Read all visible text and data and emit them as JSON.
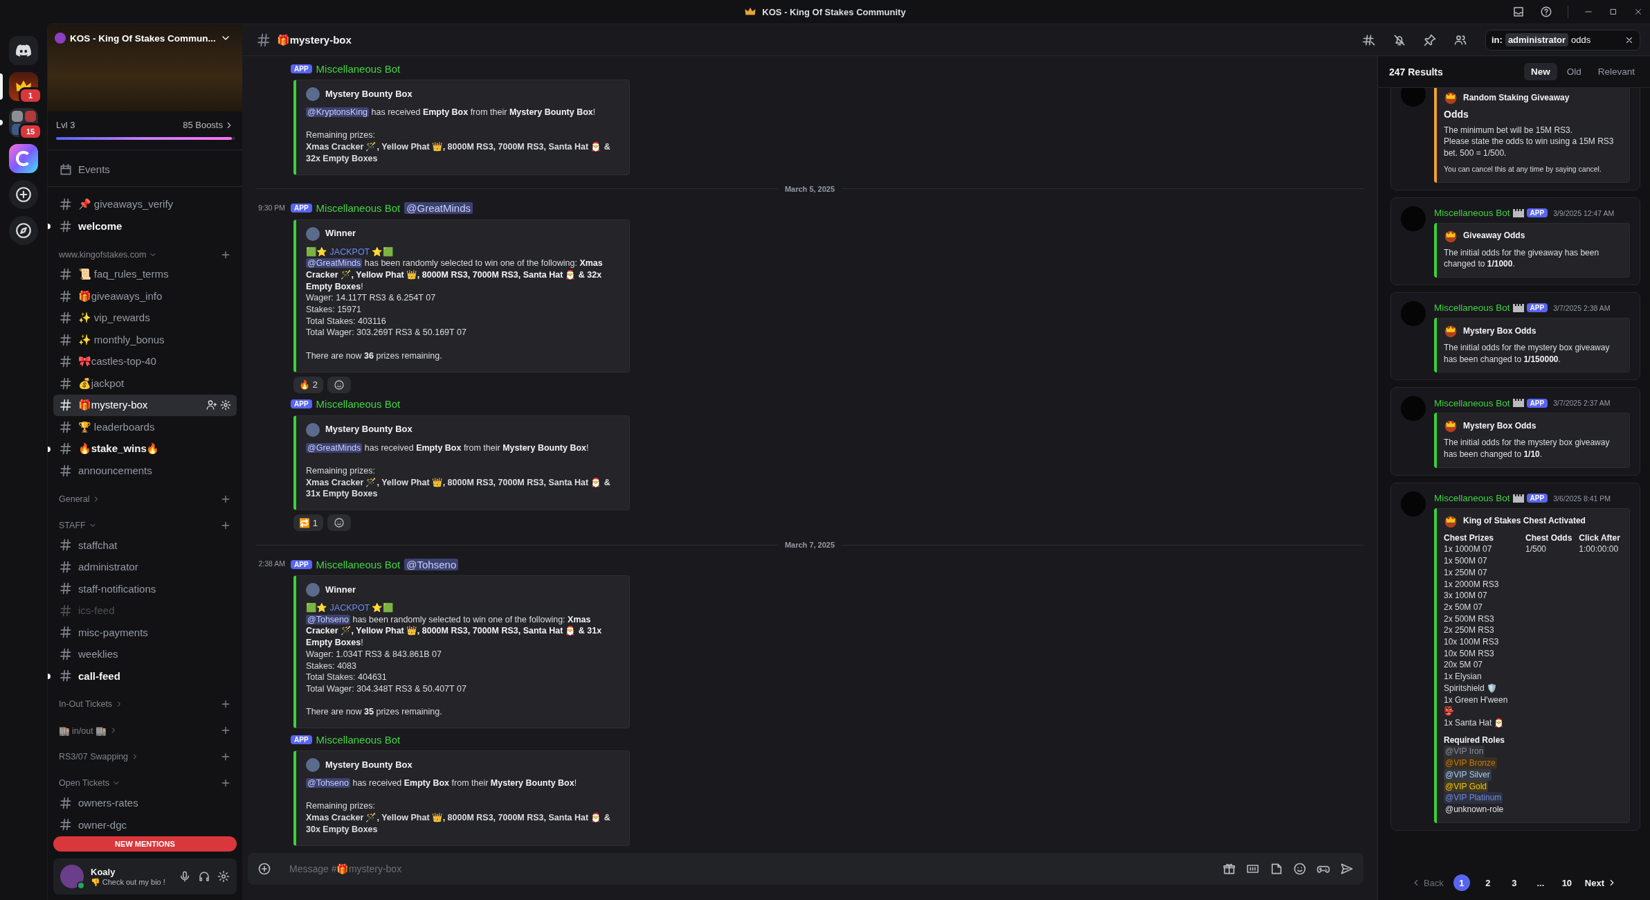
{
  "window": {
    "title": "KOS - King Of Stakes Community"
  },
  "servers": [
    {
      "kind": "home",
      "selected": false,
      "unread": false
    },
    {
      "kind": "server",
      "badge": "1",
      "selected": true,
      "unread": false
    },
    {
      "kind": "folder",
      "badge": "15",
      "selected": false,
      "unread": true
    },
    {
      "kind": "app",
      "selected": false,
      "unread": false
    },
    {
      "kind": "add",
      "selected": false,
      "unread": false
    },
    {
      "kind": "discover",
      "selected": false,
      "unread": false
    }
  ],
  "server": {
    "name": "KOS - King Of Stakes Commun...",
    "tier": "Lvl 3",
    "boosts": "85 Boosts",
    "boost_bar": {
      "level": 0.98
    }
  },
  "sidebar": {
    "items": [
      {
        "kind": "events",
        "name": "Events"
      },
      {
        "kind": "channel",
        "name": "📌 giveaways_verify",
        "selected": false,
        "unread": false,
        "muted": false
      },
      {
        "kind": "channel",
        "name": "welcome",
        "selected": false,
        "unread": true,
        "muted": false
      },
      {
        "kind": "category",
        "name": "www.kingofstakes.com",
        "expanded": true
      },
      {
        "kind": "channel",
        "name": "📜 faq_rules_terms",
        "selected": false,
        "unread": false,
        "muted": false
      },
      {
        "kind": "channel",
        "name": "🎁giveaways_info",
        "selected": false,
        "unread": false,
        "muted": false
      },
      {
        "kind": "channel",
        "name": "✨ vip_rewards",
        "selected": false,
        "unread": false,
        "muted": false
      },
      {
        "kind": "channel",
        "name": "✨ monthly_bonus",
        "selected": false,
        "unread": false,
        "muted": false
      },
      {
        "kind": "channel",
        "name": "🎀castles-top-40",
        "selected": false,
        "unread": false,
        "muted": false
      },
      {
        "kind": "channel",
        "name": "💰jackpot",
        "selected": false,
        "unread": false,
        "muted": false
      },
      {
        "kind": "channel",
        "name": "🎁mystery-box",
        "selected": true,
        "unread": false,
        "muted": false
      },
      {
        "kind": "channel",
        "name": "🏆 leaderboards",
        "selected": false,
        "unread": false,
        "muted": false
      },
      {
        "kind": "channel",
        "name": "🔥stake_wins🔥",
        "selected": false,
        "unread": true,
        "muted": false
      },
      {
        "kind": "channel",
        "name": "announcements",
        "selected": false,
        "unread": false,
        "muted": false
      },
      {
        "kind": "category",
        "name": "General",
        "expanded": false
      },
      {
        "kind": "category",
        "name": "STAFF",
        "expanded": true
      },
      {
        "kind": "channel",
        "name": "staffchat",
        "selected": false,
        "unread": false,
        "muted": false
      },
      {
        "kind": "channel",
        "name": "administrator",
        "selected": false,
        "unread": false,
        "muted": false
      },
      {
        "kind": "channel",
        "name": "staff-notifications",
        "selected": false,
        "unread": false,
        "muted": false
      },
      {
        "kind": "channel",
        "name": "ics-feed",
        "selected": false,
        "unread": false,
        "muted": true
      },
      {
        "kind": "channel",
        "name": "misc-payments",
        "selected": false,
        "unread": false,
        "muted": false
      },
      {
        "kind": "channel",
        "name": "weeklies",
        "selected": false,
        "unread": false,
        "muted": false
      },
      {
        "kind": "channel",
        "name": "call-feed",
        "selected": false,
        "unread": true,
        "muted": false
      },
      {
        "kind": "category",
        "name": "In-Out Tickets",
        "expanded": false
      },
      {
        "kind": "category",
        "name": "🏬 in/out 🏬",
        "expanded": false
      },
      {
        "kind": "category",
        "name": "RS3/07 Swapping",
        "expanded": false
      },
      {
        "kind": "category",
        "name": "Open Tickets",
        "expanded": true
      },
      {
        "kind": "channel",
        "name": "owners-rates",
        "selected": false,
        "unread": false,
        "muted": false
      },
      {
        "kind": "channel",
        "name": "owner-dgc",
        "selected": false,
        "unread": false,
        "muted": false
      }
    ],
    "new_mentions": "NEW MENTIONS"
  },
  "user": {
    "name": "Koaly",
    "status": "👎 Check out my bio !",
    "online": true
  },
  "header": {
    "channel": "🎁mystery-box",
    "search": {
      "filter": "in:",
      "filter_value": "administrator",
      "value": "odds"
    }
  },
  "chat": {
    "messages": [
      {
        "kind": "message",
        "tag": "APP",
        "author": "Miscellaneous Bot",
        "embed": {
          "title": "Mystery Bounty Box",
          "paragraphs": [
            [
              {
                "kind": "mention",
                "mention": "@KryptonsKing",
                "text": " has received **Empty Box** from their **Mystery Bounty Box**!"
              }
            ],
            [
              {
                "kind": "text",
                "text": "Remaining prizes:"
              },
              {
                "kind": "bold",
                "text": "Xmas Cracker 🪄, Yellow Phat 👑, 8000M RS3, 7000M RS3, Santa Hat 🎅 & 32x Empty Boxes"
              }
            ]
          ]
        }
      },
      {
        "kind": "date",
        "text": "March 5, 2025"
      },
      {
        "kind": "message",
        "time": "9:30 PM",
        "tag": "APP",
        "author": "Miscellaneous Bot",
        "mention": "@GreatMinds",
        "embed": {
          "title": "Winner",
          "paragraphs": [
            [
              {
                "kind": "jackpot",
                "text": "🟩⭐ JACKPOT ⭐🟩"
              },
              {
                "kind": "mention",
                "mention": "@GreatMinds",
                "text": " has been randomly selected to win one of the following: **Xmas Cracker 🪄, Yellow Phat 👑, 8000M RS3, 7000M RS3, Santa Hat 🎅 & 32x Empty Boxes**!"
              },
              {
                "kind": "text",
                "text": "Wager: 14.117T RS3 & 6.254T 07"
              },
              {
                "kind": "text",
                "text": "Stakes: 15971"
              },
              {
                "kind": "text",
                "text": "Total Stakes: 403116"
              },
              {
                "kind": "text",
                "text": "Total Wager: 303.269T RS3 & 50.169T 07"
              }
            ],
            [
              {
                "kind": "text",
                "text": "There are now **36** prizes remaining."
              }
            ]
          ]
        },
        "reactions": [
          {
            "emoji": "🔥",
            "count": "2"
          }
        ]
      },
      {
        "kind": "message",
        "tag": "APP",
        "author": "Miscellaneous Bot",
        "embed": {
          "title": "Mystery Bounty Box",
          "paragraphs": [
            [
              {
                "kind": "mention",
                "mention": "@GreatMinds",
                "text": " has received **Empty Box** from their **Mystery Bounty Box**!"
              }
            ],
            [
              {
                "kind": "text",
                "text": "Remaining prizes:"
              },
              {
                "kind": "bold",
                "text": "Xmas Cracker 🪄, Yellow Phat 👑, 8000M RS3, 7000M RS3, Santa Hat 🎅 & 31x Empty Boxes"
              }
            ]
          ]
        },
        "reactions": [
          {
            "emoji": "🔁",
            "count": "1"
          }
        ]
      },
      {
        "kind": "date",
        "text": "March 7, 2025"
      },
      {
        "kind": "message",
        "time": "2:38 AM",
        "tag": "APP",
        "author": "Miscellaneous Bot",
        "mention": "@Tohseno",
        "embed": {
          "title": "Winner",
          "paragraphs": [
            [
              {
                "kind": "jackpot",
                "text": "🟩⭐ JACKPOT ⭐🟩"
              },
              {
                "kind": "mention",
                "mention": "@Tohseno",
                "text": " has been randomly selected to win one of the following: **Xmas Cracker 🪄, Yellow Phat 👑, 8000M RS3, 7000M RS3, Santa Hat 🎅 & 31x Empty Boxes**!"
              },
              {
                "kind": "text",
                "text": "Wager: 1.034T RS3 & 843.861B 07"
              },
              {
                "kind": "text",
                "text": "Stakes: 4083"
              },
              {
                "kind": "text",
                "text": "Total Stakes: 404631"
              },
              {
                "kind": "text",
                "text": "Total Wager: 304.348T RS3 & 50.407T 07"
              }
            ],
            [
              {
                "kind": "text",
                "text": "There are now **35** prizes remaining."
              }
            ]
          ]
        }
      },
      {
        "kind": "message",
        "tag": "APP",
        "author": "Miscellaneous Bot",
        "embed": {
          "title": "Mystery Bounty Box",
          "paragraphs": [
            [
              {
                "kind": "mention",
                "mention": "@Tohseno",
                "text": " has received **Empty Box** from their **Mystery Bounty Box**!"
              }
            ],
            [
              {
                "kind": "text",
                "text": "Remaining prizes:"
              },
              {
                "kind": "bold",
                "text": "Xmas Cracker 🪄, Yellow Phat 👑, 8000M RS3, 7000M RS3, Santa Hat 🎅 & 30x Empty Boxes"
              }
            ]
          ]
        }
      }
    ],
    "input": {
      "placeholder": "Message #🎁mystery-box"
    }
  },
  "search": {
    "count": "247 Results",
    "sorts": [
      {
        "label": "New",
        "selected": true
      },
      {
        "label": "Old",
        "selected": false
      },
      {
        "label": "Relevant",
        "selected": false
      }
    ],
    "results": [
      {
        "embed": {
          "color": "#f0a232",
          "title": "Random Staking Giveaway",
          "heading": "Odds",
          "lines": [
            "The minimum bet will be 15M RS3.",
            "Please state the odds to win using a 15M RS3 bet. 500 = 1/500."
          ],
          "footer": "You can cancel this at any time by saying cancel."
        }
      },
      {
        "author": "Miscellaneous Bot",
        "tag": "APP",
        "time": "3/9/2025 12:47 AM",
        "embed": {
          "color": "#3ad13a",
          "title": "Giveaway Odds",
          "lines": [
            "The initial odds for the giveaway has been changed to **1/1000**."
          ]
        }
      },
      {
        "author": "Miscellaneous Bot",
        "tag": "APP",
        "time": "3/7/2025 2:38 AM",
        "embed": {
          "color": "#3ad13a",
          "title": "Mystery Box Odds",
          "lines": [
            "The initial odds for the mystery box giveaway has been changed to **1/150000**."
          ]
        }
      },
      {
        "author": "Miscellaneous Bot",
        "tag": "APP",
        "time": "3/7/2025 2:37 AM",
        "embed": {
          "color": "#3ad13a",
          "title": "Mystery Box Odds",
          "lines": [
            "The initial odds for the mystery box giveaway has been changed to **1/10**."
          ]
        }
      },
      {
        "author": "Miscellaneous Bot",
        "tag": "APP",
        "time": "3/6/2025 8:41 PM",
        "embed": {
          "color": "#3ad13a",
          "title": "King of Stakes Chest Activated",
          "fields": [
            {
              "name": "Chest Prizes",
              "values": [
                "1x 1000M 07",
                "1x 500M 07",
                "1x 250M 07",
                "1x 2000M RS3",
                "3x 100M 07",
                "2x 50M 07",
                "2x 500M RS3",
                "2x 250M RS3",
                "10x 100M RS3",
                "10x 50M RS3",
                "20x 5M 07",
                "1x Elysian Spiritshield 🛡️",
                "1x Green H'ween 👺",
                "1x Santa Hat 🎅"
              ]
            },
            {
              "name": "Chest Odds",
              "values": [
                "1/500"
              ]
            },
            {
              "name": "Click After",
              "values": [
                "1:00:00:00"
              ]
            }
          ],
          "roles_title": "Required Roles",
          "roles": [
            {
              "kind": "role",
              "name": "@VIP Iron",
              "color": "#8a8e94"
            },
            {
              "kind": "role",
              "name": "@VIP Bronze",
              "color": "#c27c0e"
            },
            {
              "kind": "role",
              "name": "@VIP Silver",
              "color": "#a9cdeb"
            },
            {
              "kind": "role",
              "name": "@VIP Gold",
              "color": "#f1c40f"
            },
            {
              "kind": "role",
              "name": "@VIP Platinum",
              "color": "#7289da"
            },
            {
              "kind": "unknown",
              "name": "@unknown-role",
              "color": "#e3e5e8"
            }
          ]
        }
      }
    ],
    "pagination": {
      "back": {
        "label": "Back",
        "disabled": true
      },
      "pages": [
        {
          "kind": "page",
          "label": "1",
          "selected": true
        },
        {
          "kind": "page",
          "label": "2",
          "selected": false
        },
        {
          "kind": "page",
          "label": "3",
          "selected": false
        },
        {
          "kind": "gap",
          "label": "..."
        },
        {
          "kind": "page",
          "label": "10",
          "selected": false
        }
      ],
      "next": {
        "label": "Next",
        "disabled": false
      }
    }
  }
}
